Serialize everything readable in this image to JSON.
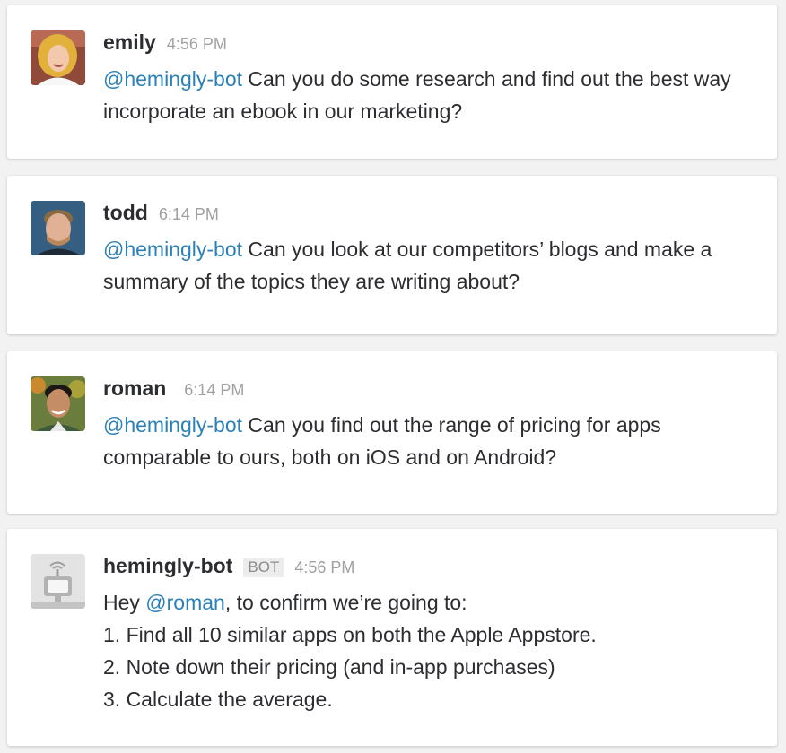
{
  "messages": [
    {
      "author": "emily",
      "time": "4:56 PM",
      "mention": "@hemingly-bot",
      "text": " Can you do some research and find out the best way incorporate an ebook in our marketing?"
    },
    {
      "author": "todd",
      "time": "6:14 PM",
      "mention": "@hemingly-bot",
      "text": " Can you look at our competitors’ blogs and make a summary of the topics they are writing about?"
    },
    {
      "author": "roman",
      "time": "6:14 PM",
      "mention": "@hemingly-bot",
      "text": " Can you find out the range of pricing for apps comparable to ours, both on iOS and on Android?"
    },
    {
      "author": "hemingly-bot",
      "badge": "BOT",
      "time": "4:56 PM",
      "line1_prefix": "Hey ",
      "line1_mention": "@roman",
      "line1_suffix": ", to confirm we’re going to:",
      "steps": [
        "1. Find all 10 similar apps on both the Apple Appstore.",
        "2. Note down their pricing (and in-app purchases)",
        "3. Calculate the average."
      ]
    }
  ],
  "colors": {
    "mention": "#2a80b9",
    "name": "#2c2d30",
    "timestamp": "#a0a0a2"
  }
}
